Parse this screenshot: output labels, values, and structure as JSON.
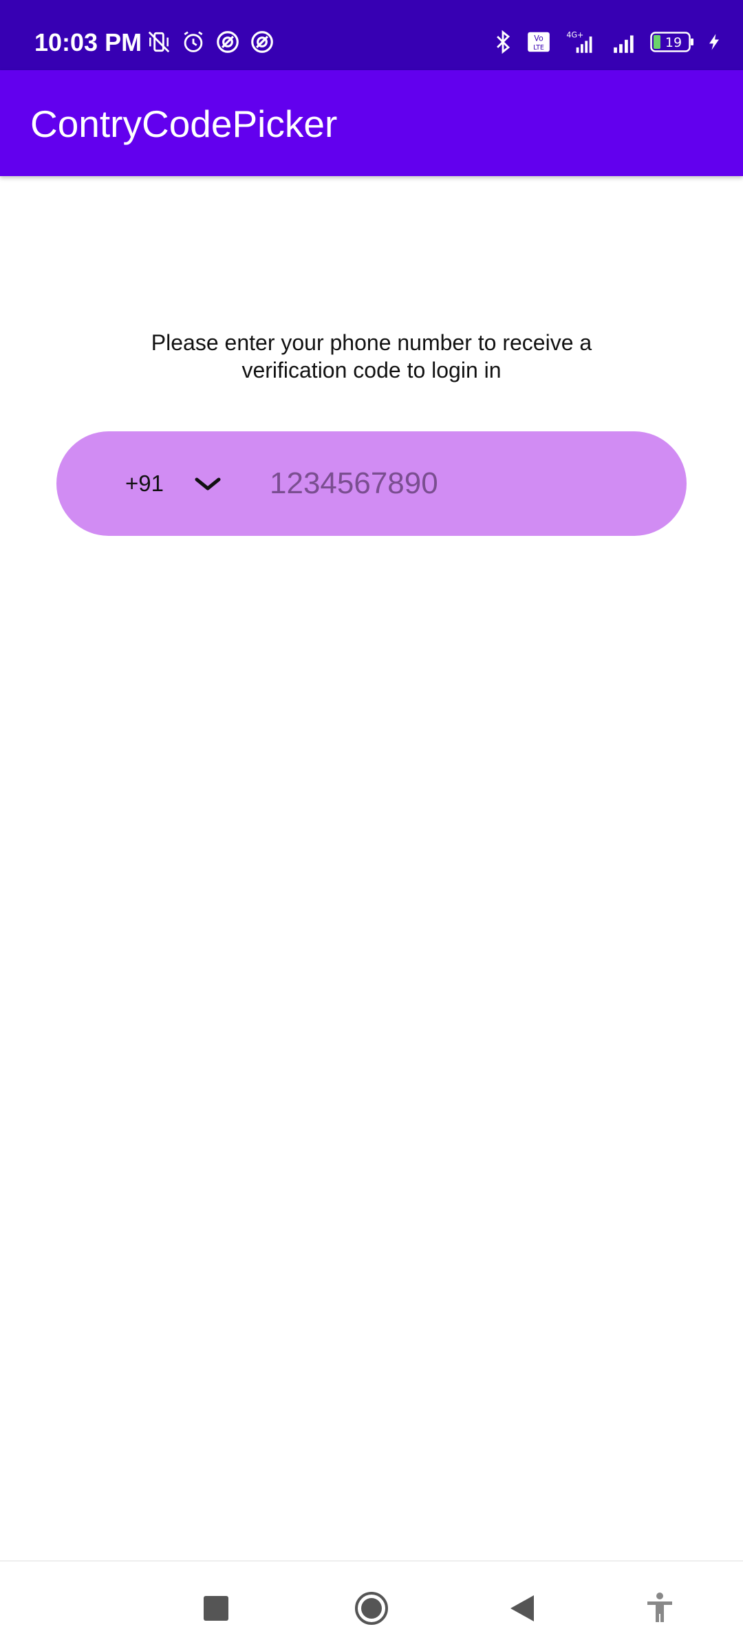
{
  "status_bar": {
    "time": "10:03 PM",
    "battery": "19",
    "icons_left": [
      "vibrate-off-icon",
      "alarm-icon",
      "hotspot-icon",
      "hotspot-icon"
    ],
    "icons_right": [
      "bluetooth-icon",
      "volte-icon",
      "signal-4g-icon",
      "signal-icon",
      "battery-icon",
      "charging-icon"
    ]
  },
  "app_bar": {
    "title": "ContryCodePicker"
  },
  "main": {
    "prompt": "Please enter your phone number to receive a verification code to login in",
    "country_code": "+91",
    "phone_placeholder": "1234567890",
    "phone_value": ""
  },
  "nav_bar": {
    "buttons": [
      "recents-button",
      "home-button",
      "back-button",
      "accessibility-button"
    ]
  },
  "colors": {
    "status_bar": "#3700b3",
    "app_bar": "#6200ee",
    "phone_field": "#d18cf3"
  }
}
